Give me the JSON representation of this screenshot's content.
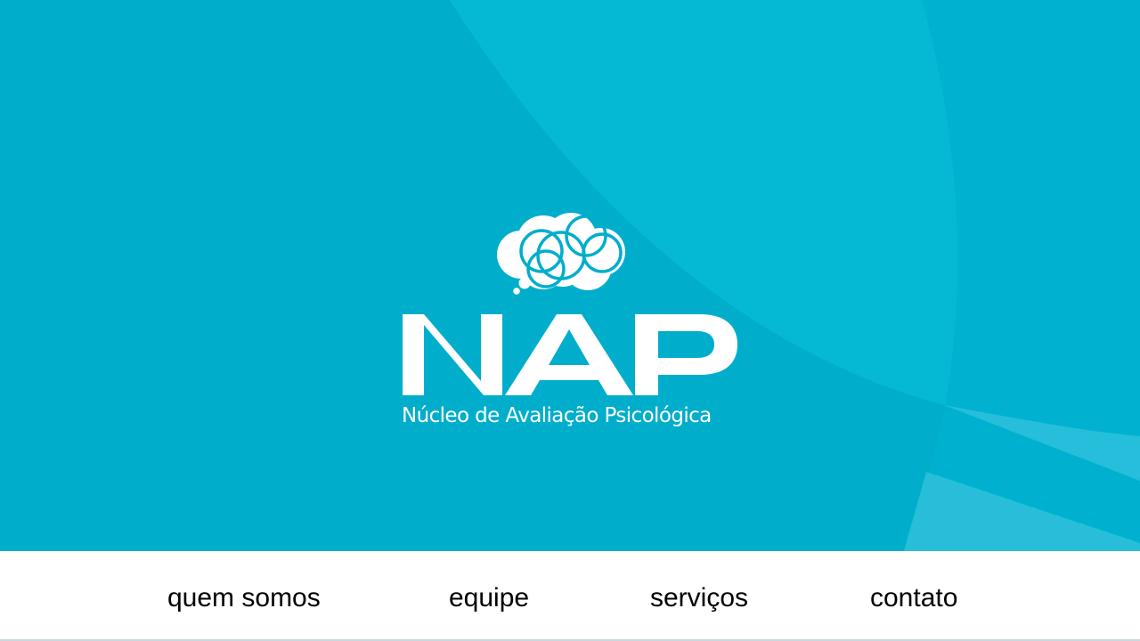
{
  "brand": {
    "name": "NAP",
    "tagline": "Núcleo de Avaliação Psicológica",
    "logo_icon": "thought-cloud-icon",
    "colors": {
      "hero_bg": "#00aecc",
      "white": "#ffffff",
      "nav_text": "#000000"
    }
  },
  "nav": {
    "items": [
      {
        "label": "quem somos"
      },
      {
        "label": "equipe"
      },
      {
        "label": "serviços"
      },
      {
        "label": "contato"
      }
    ]
  }
}
